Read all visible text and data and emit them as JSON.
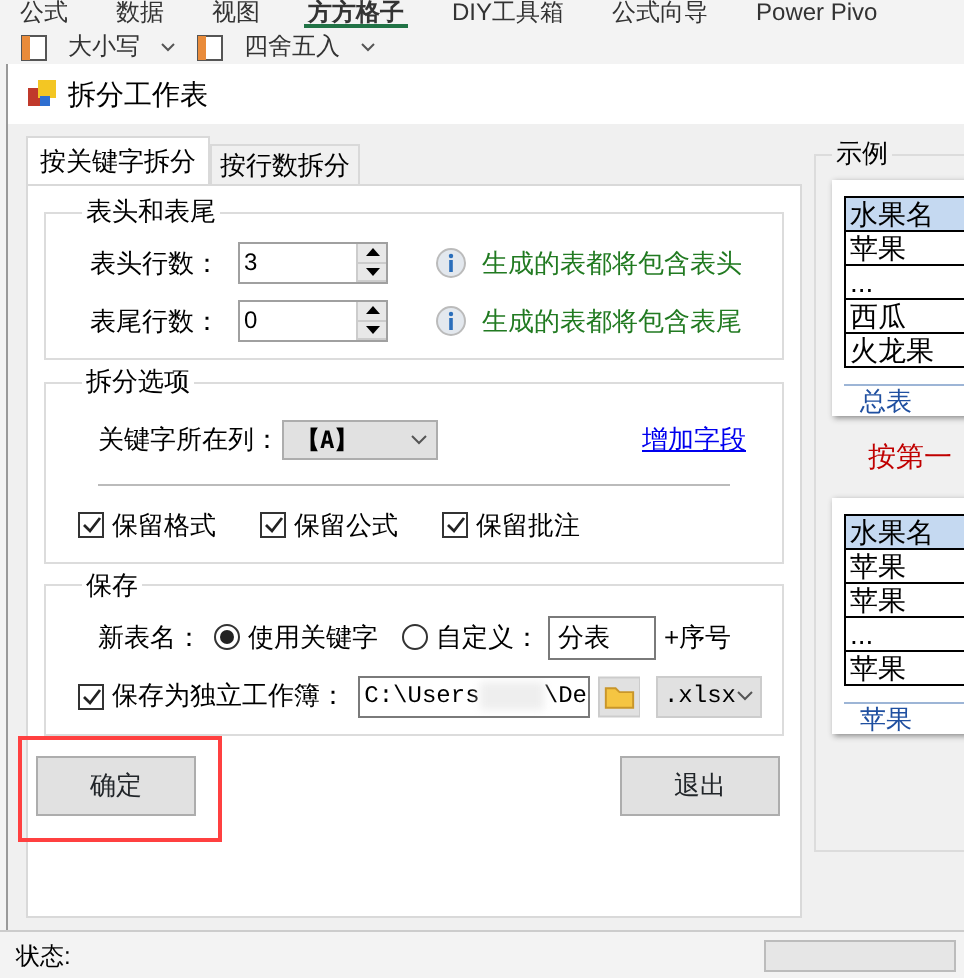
{
  "ribbon": {
    "tabs": [
      {
        "label": "公式",
        "selected": false
      },
      {
        "label": "数据",
        "selected": false
      },
      {
        "label": "视图",
        "selected": false
      },
      {
        "label": "方方格子",
        "selected": true
      },
      {
        "label": "DIY工具箱",
        "selected": false
      },
      {
        "label": "公式向导",
        "selected": false
      },
      {
        "label": "Power Pivo",
        "selected": false
      }
    ],
    "tools": [
      "大小写",
      "四舍五入"
    ]
  },
  "dialog": {
    "title": "拆分工作表",
    "tabs": [
      {
        "label": "按关键字拆分",
        "selected": true
      },
      {
        "label": "按行数拆分",
        "selected": false
      }
    ],
    "header_footer": {
      "title": "表头和表尾",
      "rows": [
        {
          "label": "表头行数：",
          "value": "3",
          "hint": "生成的表都将包含表头"
        },
        {
          "label": "表尾行数：",
          "value": "0",
          "hint": "生成的表都将包含表尾"
        }
      ]
    },
    "options": {
      "title": "拆分选项",
      "key_label": "关键字所在列：",
      "key_value": "【A】",
      "add_link": "增加字段",
      "checks": [
        {
          "label": "保留格式",
          "checked": true
        },
        {
          "label": "保留公式",
          "checked": true
        },
        {
          "label": "保留批注",
          "checked": true
        }
      ]
    },
    "save": {
      "title": "保存",
      "name_label": "新表名：",
      "radios": [
        {
          "label": "使用关键字",
          "selected": true
        },
        {
          "label": "自定义：",
          "selected": false
        }
      ],
      "custom_value": "分表",
      "suffix": "+序号",
      "separate": {
        "label": "保存为独立工作簿：",
        "checked": true
      },
      "path_start": "C:\\Users",
      "path_end": "\\De",
      "format": ".xlsx"
    },
    "buttons": [
      {
        "label": "确定",
        "highlighted": true
      },
      {
        "label": "退出",
        "highlighted": false
      }
    ],
    "example": {
      "title": "示例",
      "sheets": [
        {
          "rows": [
            "水果名",
            "苹果",
            "...",
            "西瓜",
            "火龙果"
          ],
          "tab": "总表"
        },
        {
          "rows": [
            "水果名",
            "苹果",
            "苹果",
            "...",
            "苹果"
          ],
          "tab": "苹果"
        }
      ],
      "caption": "按第一"
    }
  },
  "status_bar": {
    "label": "状态:",
    "progress": {
      "level": 0
    }
  }
}
